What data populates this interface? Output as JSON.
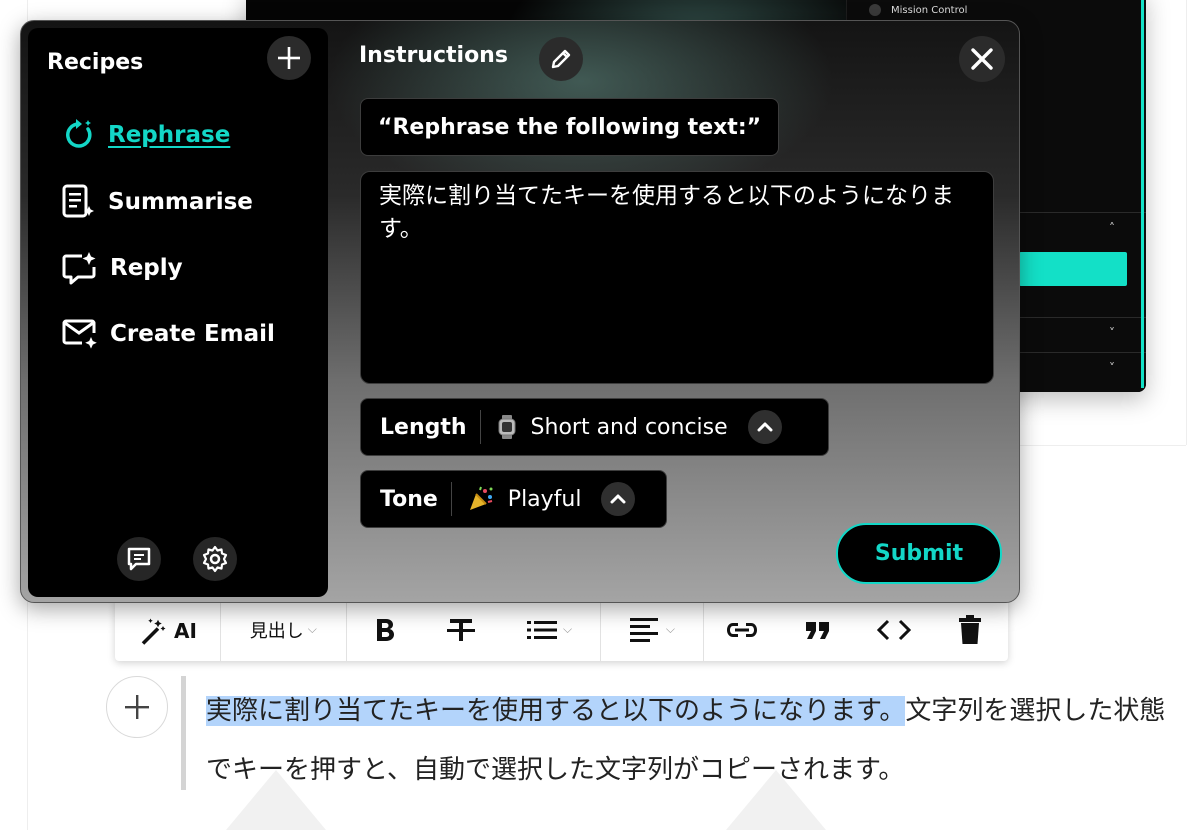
{
  "background_app": {
    "panel_item": "Mission Control"
  },
  "popup": {
    "sidebar": {
      "title": "Recipes",
      "items": [
        {
          "label": "Rephrase",
          "icon": "rephrase-icon",
          "active": true
        },
        {
          "label": "Summarise",
          "icon": "summarise-icon",
          "active": false
        },
        {
          "label": "Reply",
          "icon": "reply-icon",
          "active": false
        },
        {
          "label": "Create Email",
          "icon": "create-email-icon",
          "active": false
        }
      ]
    },
    "instructions": {
      "title": "Instructions",
      "prompt": "“Rephrase the following text:”",
      "input_text": "実際に割り当てたキーを使用すると以下のようになります。"
    },
    "length": {
      "label": "Length",
      "value": "Short and concise",
      "icon": "watch-icon"
    },
    "tone": {
      "label": "Tone",
      "value": "Playful",
      "icon": "party-popper-icon"
    },
    "submit_label": "Submit"
  },
  "toolbar": {
    "ai_label": "AI",
    "heading_label": "見出し"
  },
  "editor": {
    "selected_text": "実際に割り当てたキーを使用すると以下のようになります。",
    "line1_rest": "文字列を選択した状態",
    "line2": "でキーを押すと、自動で選択した文字列がコピーされます。"
  },
  "colors": {
    "accent": "#13d7c7",
    "selection": "#b3d4fb"
  }
}
